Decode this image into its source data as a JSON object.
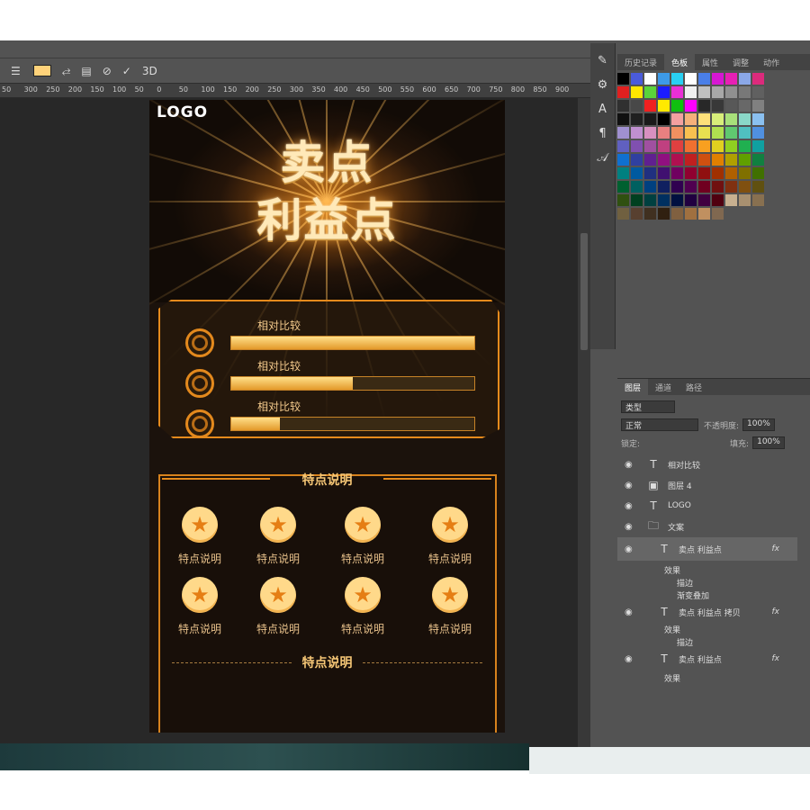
{
  "toolbar": {
    "threed_label": "3D"
  },
  "ruler": {
    "ticks": [
      "50",
      "300",
      "250",
      "200",
      "150",
      "100",
      "50",
      "0",
      "50",
      "100",
      "150",
      "200",
      "250",
      "300",
      "350",
      "400",
      "450",
      "500",
      "550",
      "600",
      "650",
      "700",
      "750",
      "800",
      "850",
      "900"
    ]
  },
  "document": {
    "logo": "LOGO",
    "headline_line1": "卖点",
    "headline_line2": "利益点",
    "compare_rows": [
      {
        "label": "相对比较",
        "progress": 1.0
      },
      {
        "label": "相对比较",
        "progress": 0.5
      },
      {
        "label": "相对比较",
        "progress": 0.2
      }
    ],
    "feature_title": "特点说明",
    "features_row1": [
      "特点说明",
      "特点说明",
      "特点说明",
      "特点说明"
    ],
    "features_row2": [
      "特点说明",
      "特点说明",
      "特点说明",
      "特点说明"
    ],
    "feature_title2": "特点说明"
  },
  "panels": {
    "top_tabs": [
      "历史记录",
      "色板",
      "属性",
      "调整",
      "动作"
    ],
    "active_top_tab": "色板",
    "layer_tabs": [
      "图层",
      "通道",
      "路径"
    ],
    "kind_filter": "类型",
    "blend_mode": "正常",
    "opacity_label": "不透明度:",
    "opacity_value": "100%",
    "lock_label": "锁定:",
    "fill_label": "填充:",
    "fill_value": "100%",
    "layers": [
      {
        "name": "相对比较",
        "type": "T"
      },
      {
        "name": "图层 4",
        "type": "img"
      },
      {
        "name": "LOGO",
        "type": "T"
      },
      {
        "name": "文案",
        "type": "folder"
      },
      {
        "name": "卖点 利益点",
        "type": "T"
      },
      {
        "name": "卖点 利益点 拷贝",
        "type": "T"
      },
      {
        "name": "卖点 利益点",
        "type": "T"
      }
    ],
    "effects_label": "效果",
    "effect_stroke": "描边",
    "effect_gradient": "渐变叠加",
    "fx_label": "fx"
  },
  "colors": {
    "accent": "#e58a1c",
    "bg": "#535353"
  }
}
